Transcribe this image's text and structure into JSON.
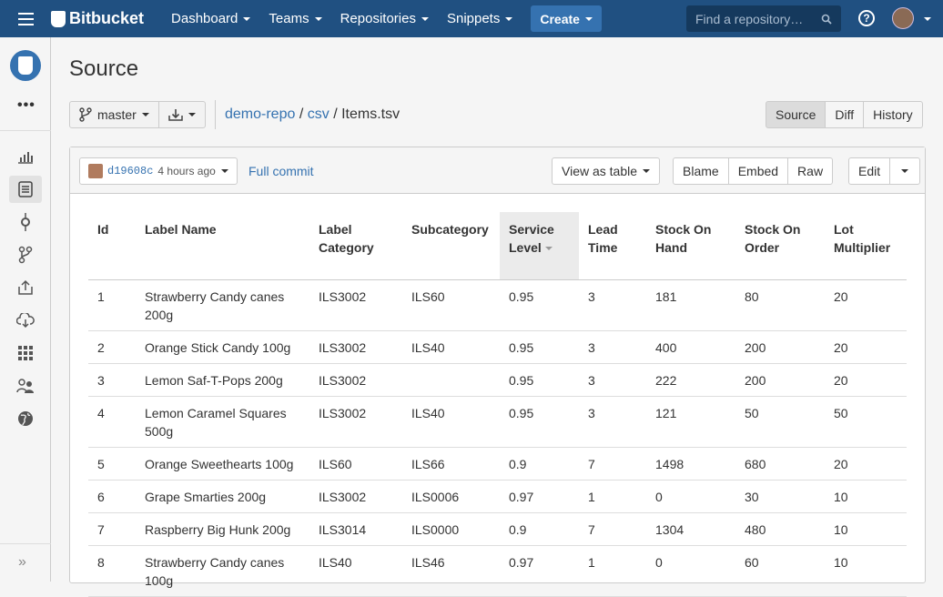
{
  "topnav": {
    "logo": "Bitbucket",
    "items": [
      "Dashboard",
      "Teams",
      "Repositories",
      "Snippets"
    ],
    "create": "Create",
    "search_placeholder": "Find a repository…",
    "help": "?"
  },
  "page": {
    "title": "Source",
    "branch": "master",
    "breadcrumb": {
      "repo": "demo-repo",
      "sep1": "/",
      "folder": "csv",
      "sep2": "/",
      "file": "Items.tsv"
    },
    "view_tabs": [
      "Source",
      "Diff",
      "History"
    ],
    "active_tab": "Source"
  },
  "file": {
    "commit_hash": "d19608c",
    "commit_time": "4 hours ago",
    "full_commit": "Full commit",
    "view_as": "View as table",
    "actions": [
      "Blame",
      "Embed",
      "Raw"
    ],
    "edit": "Edit"
  },
  "table": {
    "headers": [
      "Id",
      "Label Name",
      "Label Category",
      "Subcategory",
      "Service Level",
      "Lead Time",
      "Stock On Hand",
      "Stock On Order",
      "Lot Multiplier"
    ],
    "rows": [
      [
        "1",
        "Strawberry Candy canes 200g",
        "ILS3002",
        "ILS60",
        "0.95",
        "3",
        "181",
        "80",
        "20"
      ],
      [
        "2",
        "Orange Stick Candy 100g",
        "ILS3002",
        "ILS40",
        "0.95",
        "3",
        "400",
        "200",
        "20"
      ],
      [
        "3",
        "Lemon Saf-T-Pops 200g",
        "ILS3002",
        "",
        "0.95",
        "3",
        "222",
        "200",
        "20"
      ],
      [
        "4",
        "Lemon Caramel Squares 500g",
        "ILS3002",
        "ILS40",
        "0.95",
        "3",
        "121",
        "50",
        "50"
      ],
      [
        "5",
        "Orange Sweethearts 100g",
        "ILS60",
        "ILS66",
        "0.9",
        "7",
        "1498",
        "680",
        "20"
      ],
      [
        "6",
        "Grape Smarties 200g",
        "ILS3002",
        "ILS0006",
        "0.97",
        "1",
        "0",
        "30",
        "10"
      ],
      [
        "7",
        "Raspberry Big Hunk 200g",
        "ILS3014",
        "ILS0000",
        "0.9",
        "7",
        "1304",
        "480",
        "10"
      ],
      [
        "8",
        "Strawberry Candy canes 100g",
        "ILS40",
        "ILS46",
        "0.97",
        "1",
        "0",
        "60",
        "10"
      ]
    ]
  },
  "colors": {
    "topbar": "#205081",
    "link": "#3572b0",
    "create": "#3572b0"
  }
}
